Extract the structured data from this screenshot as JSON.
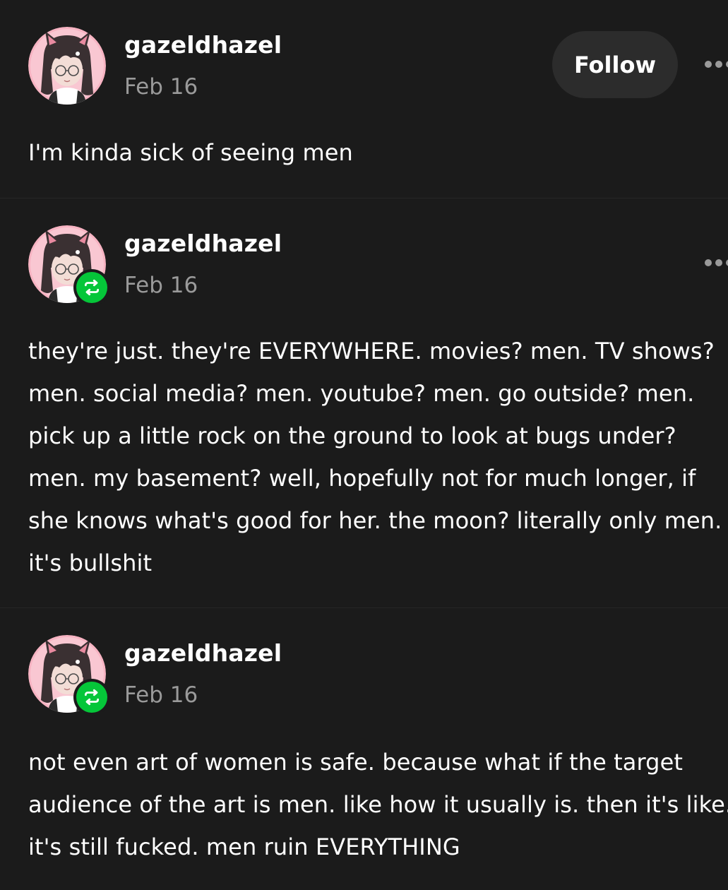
{
  "colors": {
    "background": "#1b1b1b",
    "reblog_badge": "#05c639",
    "follow_button_bg": "#2c2c2c",
    "muted_text": "#9a9a9a"
  },
  "posts": [
    {
      "username": "gazeldhazel",
      "date": "Feb 16",
      "is_reblog": false,
      "follow_label": "Follow",
      "body": "I'm kinda sick of seeing men"
    },
    {
      "username": "gazeldhazel",
      "date": "Feb 16",
      "is_reblog": true,
      "body": "they're just. they're EVERYWHERE. movies? men. TV shows? men. social media? men. youtube? men. go outside? men. pick up a little rock on the ground to look at bugs under? men. my basement? well, hopefully not for much longer, if she knows what's good for her. the moon? literally only men. it's bullshit"
    },
    {
      "username": "gazeldhazel",
      "date": "Feb 16",
      "is_reblog": true,
      "body": "not even art of women is safe. because what if the target audience of the art is men. like how it usually is. then it's like. it's still fucked. men ruin EVERYTHING"
    }
  ],
  "icons": {
    "avatar": "avatar-icon",
    "reblog": "reblog-icon",
    "more": "more-options-icon"
  }
}
